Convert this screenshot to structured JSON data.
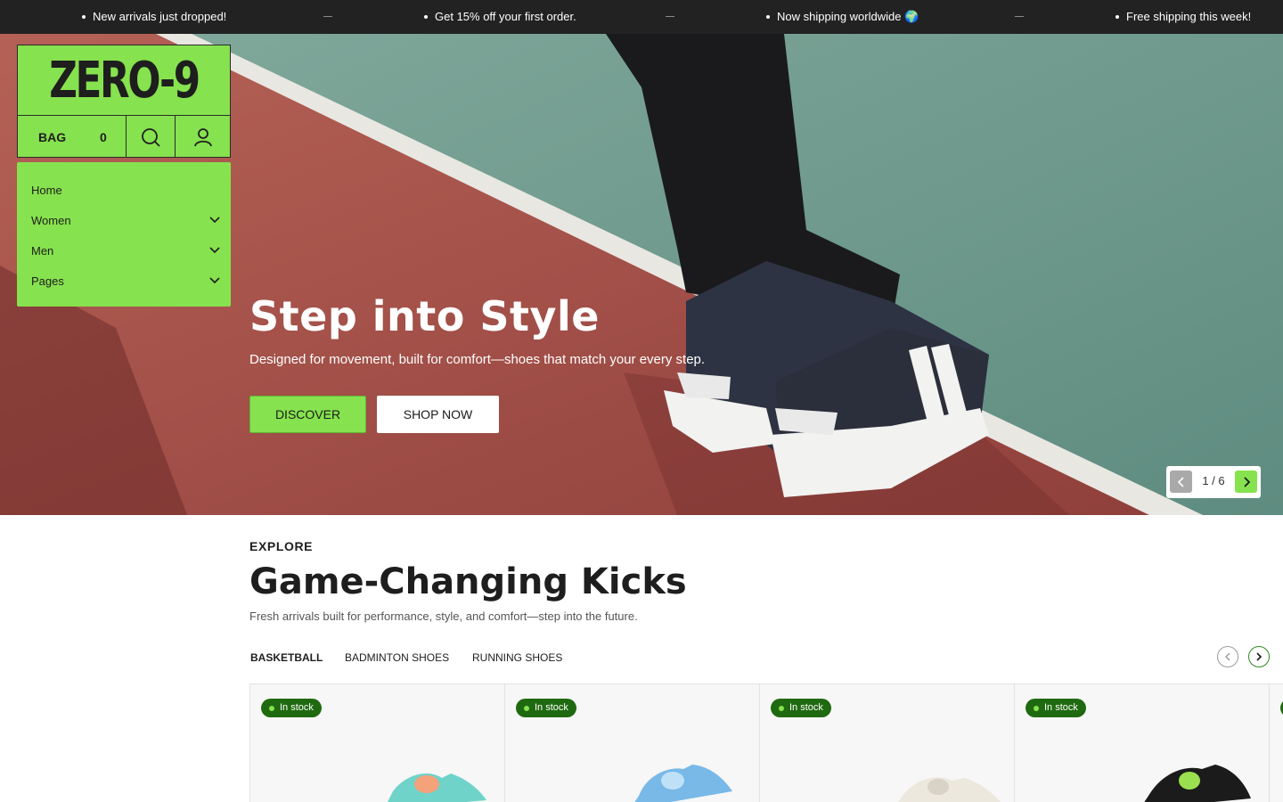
{
  "announcements": [
    "New arrivals just dropped!",
    "Get 15% off your first order.",
    "Now shipping worldwide 🌍",
    "Free shipping this week!"
  ],
  "brand": {
    "logo": "ZERO-9",
    "accent_color": "#86e24e",
    "dark_color": "#222222"
  },
  "header": {
    "bag_label": "BAG",
    "bag_count": "0",
    "search_icon": "search-icon",
    "account_icon": "user-icon"
  },
  "nav": {
    "items": [
      {
        "label": "Home",
        "has_submenu": false
      },
      {
        "label": "Women",
        "has_submenu": true
      },
      {
        "label": "Men",
        "has_submenu": true
      },
      {
        "label": "Pages",
        "has_submenu": true
      }
    ]
  },
  "hero": {
    "title": "Step into Style",
    "subtitle": "Designed for movement, built for comfort—shoes that match your every step.",
    "primary_button": "DISCOVER",
    "secondary_button": "SHOP NOW",
    "slide_counter": "1 / 6"
  },
  "explore": {
    "eyebrow": "EXPLORE",
    "title": "Game-Changing Kicks",
    "subtitle": "Fresh arrivals built for performance, style, and comfort—step into the future.",
    "tabs": [
      {
        "label": "BASKETBALL",
        "active": true
      },
      {
        "label": "BADMINTON SHOES",
        "active": false
      },
      {
        "label": "RUNNING SHOES",
        "active": false
      }
    ]
  },
  "products": [
    {
      "badge": "In stock"
    },
    {
      "badge": "In stock"
    },
    {
      "badge": "In stock"
    },
    {
      "badge": "In stock"
    }
  ]
}
